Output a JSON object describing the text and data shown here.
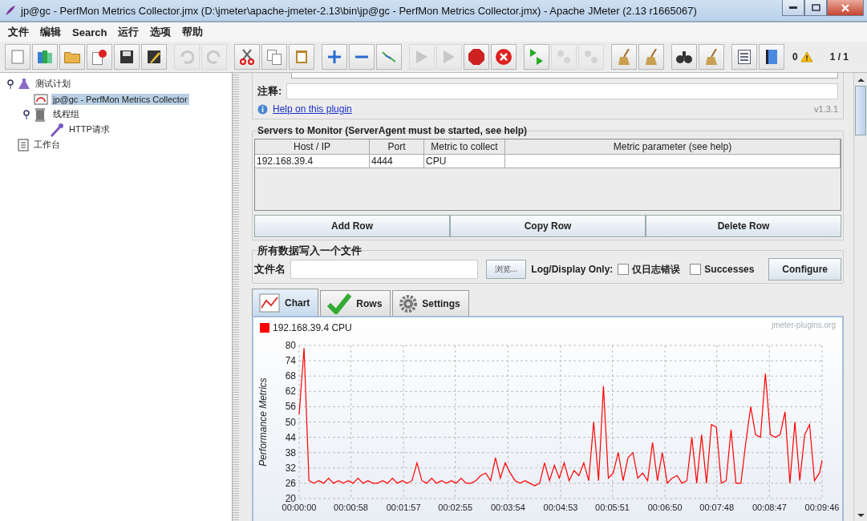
{
  "window": {
    "title": "jp@gc - PerfMon Metrics Collector.jmx (D:\\jmeter\\apache-jmeter-2.13\\bin\\jp@gc - PerfMon Metrics Collector.jmx) - Apache JMeter (2.13 r1665067)"
  },
  "menu": [
    "文件",
    "编辑",
    "Search",
    "运行",
    "选项",
    "帮助"
  ],
  "toolbar": [
    {
      "disabled": false
    },
    {
      "disabled": false
    },
    {
      "disabled": false
    },
    {
      "disabled": false
    },
    {
      "disabled": false
    },
    {
      "disabled": false
    },
    {
      "disabled": true
    },
    {
      "disabled": true
    },
    {
      "disabled": false
    },
    {
      "disabled": false
    },
    {
      "disabled": false
    },
    {
      "disabled": false
    },
    {
      "disabled": false
    },
    {
      "disabled": false
    },
    {
      "disabled": true
    },
    {
      "disabled": true
    },
    {
      "disabled": false
    },
    {
      "disabled": false
    },
    {
      "disabled": false
    },
    {
      "disabled": true
    },
    {
      "disabled": true
    },
    {
      "disabled": false
    },
    {
      "disabled": false
    },
    {
      "disabled": false
    },
    {
      "disabled": false
    },
    {
      "disabled": false
    },
    {
      "disabled": false
    }
  ],
  "status": {
    "error_count": "0",
    "threads": "1 / 1"
  },
  "tree": [
    {
      "label": "测试计划",
      "kind": "plan",
      "selected": false,
      "expanded": true,
      "children": [
        {
          "label": "jp@gc - PerfMon Metrics Collector",
          "kind": "listener",
          "selected": true
        },
        {
          "label": "线程组",
          "kind": "threads",
          "selected": false,
          "expanded": true,
          "children": [
            {
              "label": "HTTP请求",
              "kind": "sampler",
              "selected": false
            }
          ]
        }
      ]
    },
    {
      "label": "工作台",
      "kind": "workbench",
      "selected": false
    }
  ],
  "form": {
    "comment_label": "注释:",
    "help_link": "Help on this plugin",
    "version": "v1.3.1"
  },
  "servers": {
    "title": "Servers to Monitor (ServerAgent must be started, see help)",
    "columns": [
      "Host / IP",
      "Port",
      "Metric to collect",
      "Metric parameter (see help)"
    ],
    "rows": [
      [
        "192.168.39.4",
        "4444",
        "CPU",
        ""
      ]
    ],
    "buttons": [
      "Add Row",
      "Copy Row",
      "Delete Row"
    ]
  },
  "file_output": {
    "title": "所有数据写入一个文件",
    "file_label": "文件名",
    "browse": "浏览...",
    "log_label": "Log/Display Only:",
    "checkboxes": [
      {
        "label": "仅日志错误",
        "checked": false
      },
      {
        "label": "Successes",
        "checked": false
      }
    ],
    "configure": "Configure"
  },
  "tabs": [
    {
      "label": "Chart",
      "kind": "chart",
      "selected": true
    },
    {
      "label": "Rows",
      "kind": "rows",
      "selected": false
    },
    {
      "label": "Settings",
      "kind": "settings",
      "selected": false
    }
  ],
  "watermark_text": "jmeter-plugins.org",
  "chart_data": {
    "type": "line",
    "ylabel": "Performance Metrics",
    "grid": true,
    "xlim": [
      0,
      586
    ],
    "ylim": [
      20,
      80
    ],
    "yticks": [
      20,
      26,
      32,
      38,
      44,
      50,
      56,
      62,
      68,
      74,
      80
    ],
    "xticks": [
      {
        "value": 0,
        "label": "00:00:00"
      },
      {
        "value": 58,
        "label": "00:00:58"
      },
      {
        "value": 117,
        "label": "00:01:57"
      },
      {
        "value": 175,
        "label": "00:02:55"
      },
      {
        "value": 234,
        "label": "00:03:54"
      },
      {
        "value": 293,
        "label": "00:04:53"
      },
      {
        "value": 351,
        "label": "00:05:51"
      },
      {
        "value": 410,
        "label": "00:06:50"
      },
      {
        "value": 468,
        "label": "00:07:48"
      },
      {
        "value": 527,
        "label": "00:08:47"
      },
      {
        "value": 586,
        "label": "00:09:46"
      }
    ],
    "x": [
      0,
      5.5,
      11,
      16.5,
      22,
      27.5,
      33,
      38.5,
      44,
      49.5,
      55,
      60.5,
      66,
      71.5,
      77,
      82.5,
      88,
      93.5,
      99,
      104.5,
      110,
      115.5,
      121,
      126.5,
      132,
      137.5,
      143,
      148.5,
      154,
      159.5,
      165,
      170.5,
      176,
      181.5,
      187,
      192.5,
      198,
      203.5,
      209,
      214.5,
      220,
      225.5,
      231,
      236.5,
      242,
      247.5,
      253,
      258.5,
      264,
      269.5,
      275,
      280.5,
      286,
      291.5,
      297,
      302.5,
      308,
      313.5,
      319,
      324.5,
      330,
      335.5,
      341,
      346.5,
      352,
      357.5,
      363,
      368.5,
      374,
      379.5,
      385,
      390.5,
      396,
      401.5,
      407,
      412.5,
      418,
      423.5,
      429,
      434.5,
      440,
      445.5,
      451,
      456.5,
      462,
      467.5,
      473,
      478.5,
      484,
      489.5,
      495,
      500.5,
      506,
      511.5,
      517,
      522.5,
      528,
      533.5,
      539,
      544.5,
      550,
      555.5,
      561,
      566.5,
      572,
      577.5,
      583,
      586
    ],
    "series": [
      {
        "name": "192.168.39.4 CPU",
        "color": "#ff0000",
        "values": [
          53,
          79,
          27,
          26,
          27,
          26,
          28,
          26,
          27,
          26,
          27,
          26,
          28,
          26,
          27,
          26,
          26,
          27,
          26,
          28,
          26,
          27,
          26,
          27,
          34,
          27,
          26,
          28,
          26,
          27,
          26,
          27,
          26,
          28,
          26,
          26,
          27,
          29,
          30,
          27,
          36,
          28,
          34,
          30,
          27,
          26,
          27,
          26,
          25,
          26,
          34,
          27,
          33,
          28,
          34,
          27,
          31,
          29,
          34,
          27,
          50,
          27,
          64,
          28,
          30,
          38,
          27,
          36,
          38,
          28,
          30,
          27,
          42,
          27,
          38,
          26,
          28,
          29,
          26,
          27,
          44,
          26,
          45,
          26,
          49,
          48,
          26,
          27,
          47,
          26,
          26,
          42,
          56,
          45,
          44,
          69,
          45,
          44,
          45,
          54,
          26,
          50,
          27,
          45,
          49,
          27,
          30,
          35
        ]
      }
    ]
  }
}
